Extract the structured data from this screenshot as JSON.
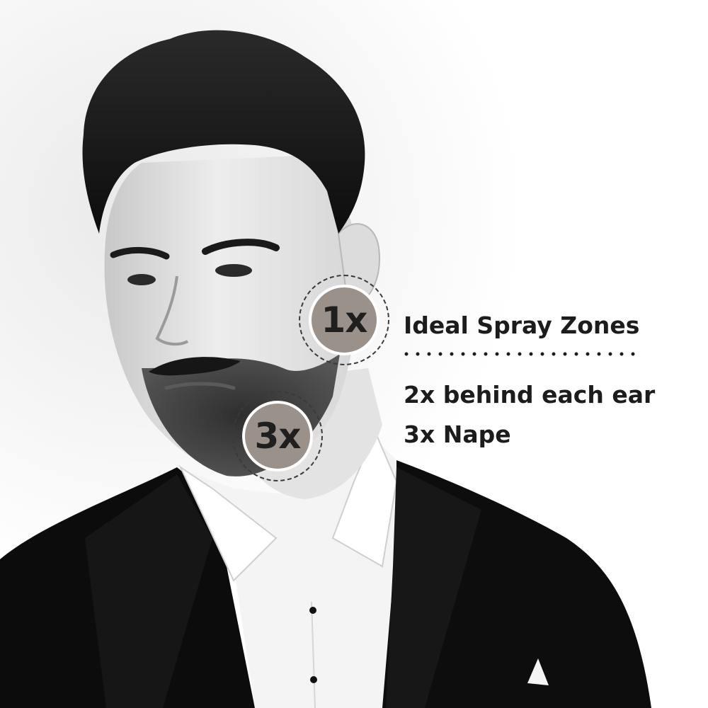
{
  "photo": {
    "subject": "man-portrait",
    "palette": [
      "#ffffff",
      "#111111",
      "#f2f2f2"
    ]
  },
  "badges": [
    {
      "label": "1x",
      "fill": "#9a928a"
    },
    {
      "label": "3x",
      "fill": "#9a928a"
    }
  ],
  "info": {
    "heading": "Ideal Spray Zones",
    "lines": [
      "2x behind each ear",
      "3x Nape"
    ]
  }
}
